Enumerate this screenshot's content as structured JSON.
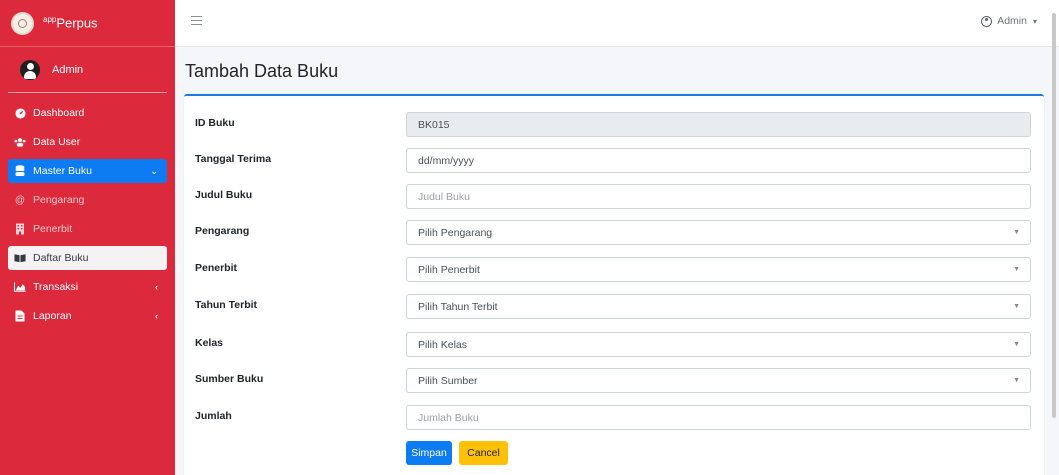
{
  "brand": {
    "prefix": "app",
    "name": "Perpus"
  },
  "user": {
    "name": "Admin"
  },
  "sidebar": {
    "items": [
      {
        "label": "Dashboard",
        "icon": "tachometer-icon"
      },
      {
        "label": "Data User",
        "icon": "users-icon"
      },
      {
        "label": "Master Buku",
        "icon": "database-icon",
        "caret": "⌄"
      },
      {
        "label": "Pengarang",
        "icon": "at-icon"
      },
      {
        "label": "Penerbit",
        "icon": "building-icon"
      },
      {
        "label": "Daftar Buku",
        "icon": "book-open-icon"
      },
      {
        "label": "Transaksi",
        "icon": "chart-area-icon",
        "caret": "‹"
      },
      {
        "label": "Laporan",
        "icon": "file-icon",
        "caret": "‹"
      }
    ]
  },
  "topbar": {
    "user_label": "Admin",
    "dropdown": "▾"
  },
  "page": {
    "title": "Tambah Data Buku"
  },
  "form": {
    "id_buku": {
      "label": "ID Buku",
      "value": "BK015"
    },
    "tanggal_terima": {
      "label": "Tanggal Terima",
      "value": "dd/mm/yyyy"
    },
    "judul_buku": {
      "label": "Judul Buku",
      "placeholder": "Judul Buku"
    },
    "pengarang": {
      "label": "Pengarang",
      "selected": "Pilih Pengarang"
    },
    "penerbit": {
      "label": "Penerbit",
      "selected": "Pilih Penerbit"
    },
    "tahun_terbit": {
      "label": "Tahun Terbit",
      "selected": "Pilih Tahun Terbit"
    },
    "kelas": {
      "label": "Kelas",
      "selected": "Pilih Kelas"
    },
    "sumber_buku": {
      "label": "Sumber Buku",
      "selected": "Pilih Sumber"
    },
    "jumlah": {
      "label": "Jumlah",
      "placeholder": "Jumlah Buku"
    },
    "save_label": "Simpan",
    "cancel_label": "Cancel"
  },
  "colors": {
    "sidebar": "#dc2a3c",
    "primary": "#0d7bf2",
    "warning": "#ffc107"
  }
}
